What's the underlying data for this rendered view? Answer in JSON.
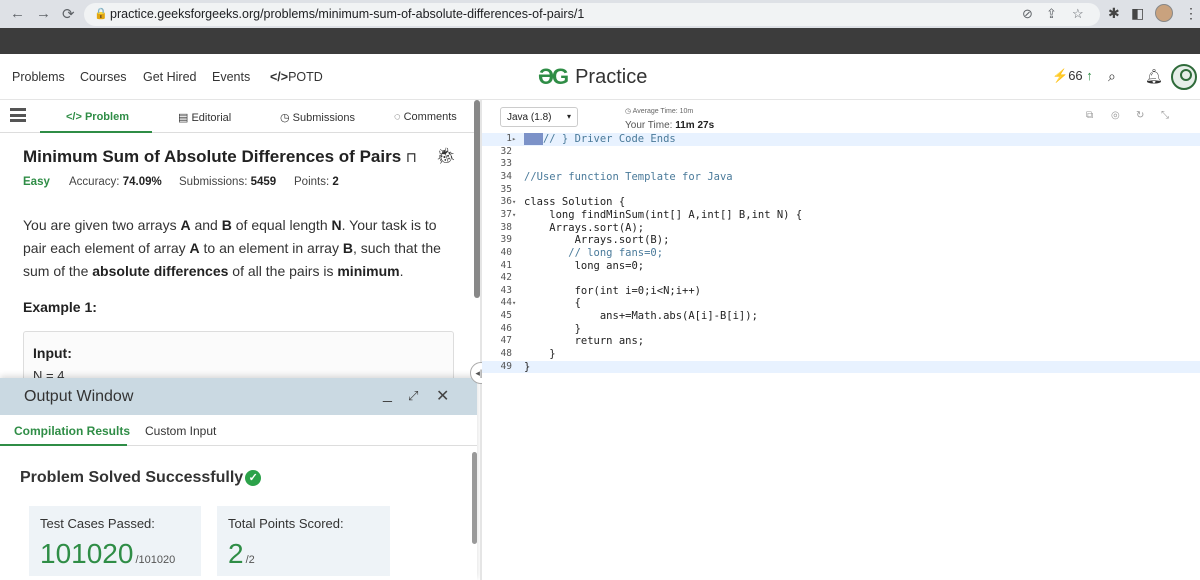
{
  "browser": {
    "back": "←",
    "forward": "→",
    "reload": "⟳",
    "url": "practice.geeksforgeeks.org/problems/minimum-sum-of-absolute-differences-of-pairs/1",
    "menu": "⋮"
  },
  "topnav": {
    "links": [
      "Problems",
      "Courses",
      "Get Hired",
      "Events",
      "POTD"
    ],
    "potd_prefix": "</>",
    "logo_mark": "ƏG",
    "logo_text": "Practice",
    "streak": "66"
  },
  "tabs": [
    "Problem",
    "Editorial",
    "Submissions",
    "Comments"
  ],
  "problem": {
    "title": "Minimum Sum of Absolute Differences of Pairs",
    "difficulty": "Easy",
    "accuracy_label": "Accuracy:",
    "accuracy": "74.09%",
    "submissions_label": "Submissions:",
    "submissions": "5459",
    "points_label": "Points:",
    "points": "2",
    "desc": {
      "p1": "You are given two arrays ",
      "a": "A",
      "p2": " and ",
      "b": "B",
      "p3": " of equal length ",
      "n": "N",
      "p4": ". Your task is to pair each element of array ",
      "a2": "A",
      "p5": " to an element in array ",
      "b2": "B",
      "p6": ", such that the sum of the ",
      "abs": "absolute differences",
      "p7": " of all the pairs is ",
      "min": "minimum",
      "p8": "."
    },
    "example_title": "Example 1:",
    "input_label": "Input:",
    "input_value": "N = 4"
  },
  "output": {
    "title": "Output Window",
    "tabs": [
      "Compilation Results",
      "Custom Input"
    ],
    "status": "Problem Solved Successfully",
    "cards": [
      {
        "label": "Test Cases Passed:",
        "value": "101020",
        "max": "/101020"
      },
      {
        "label": "Total Points Scored:",
        "value": "2",
        "max": "/2"
      }
    ]
  },
  "editor": {
    "language": "Java (1.8)",
    "avg_time": "Average Time: 10m",
    "your_time_label": "Your Time:",
    "your_time": "11m 27s",
    "lines": [
      {
        "n": "1",
        "fold": "▸",
        "text": "// } Driver Code Ends",
        "cls": "cmt",
        "hl": true
      },
      {
        "n": "32",
        "text": ""
      },
      {
        "n": "33",
        "text": ""
      },
      {
        "n": "34",
        "text": "//User function Template for Java",
        "cls": "cmt"
      },
      {
        "n": "35",
        "text": ""
      },
      {
        "n": "36",
        "fold": "▾",
        "text": "class Solution {"
      },
      {
        "n": "37",
        "fold": "▾",
        "text": "    long findMinSum(int[] A,int[] B,int N) {"
      },
      {
        "n": "38",
        "text": "    Arrays.sort(A);"
      },
      {
        "n": "39",
        "text": "        Arrays.sort(B);"
      },
      {
        "n": "40",
        "text": "       // long fans=0;",
        "cls": "cmt"
      },
      {
        "n": "41",
        "text": "        long ans=0;"
      },
      {
        "n": "42",
        "text": ""
      },
      {
        "n": "43",
        "text": "        for(int i=0;i<N;i++)"
      },
      {
        "n": "44",
        "fold": "▾",
        "text": "        {"
      },
      {
        "n": "45",
        "text": "            ans+=Math.abs(A[i]-B[i]);"
      },
      {
        "n": "46",
        "text": "        }"
      },
      {
        "n": "47",
        "text": "        return ans;"
      },
      {
        "n": "48",
        "text": "    }"
      },
      {
        "n": "49",
        "text": "}",
        "hl": true
      }
    ]
  }
}
